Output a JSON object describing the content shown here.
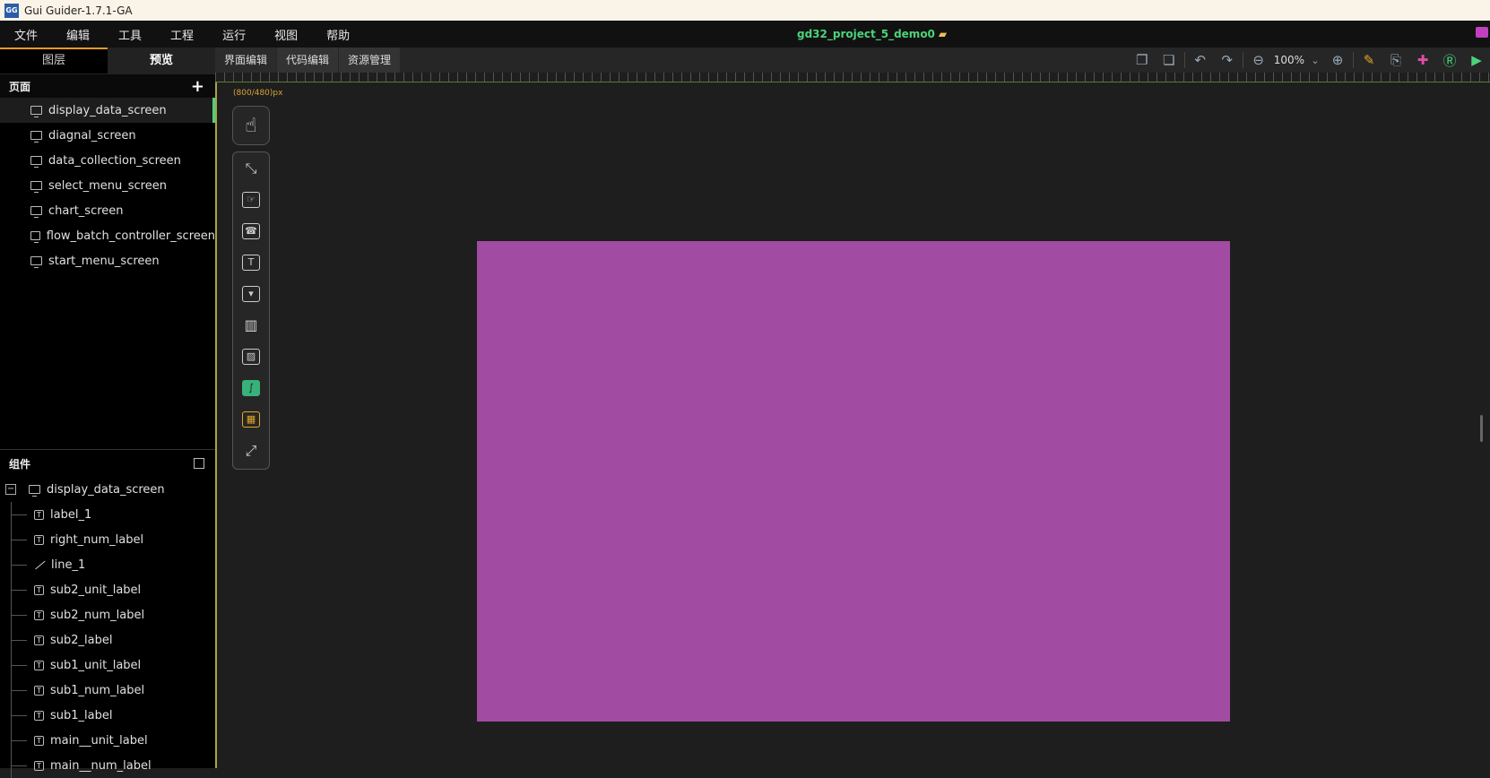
{
  "window": {
    "title": "Gui Guider-1.7.1-GA",
    "app_icon_text": "GG"
  },
  "menu": {
    "items": [
      "文件",
      "编辑",
      "工具",
      "工程",
      "运行",
      "视图",
      "帮助"
    ],
    "project_name": "gd32_project_5_demo0"
  },
  "left_tabs": {
    "layers": "图层",
    "preview": "预览"
  },
  "pages": {
    "header": "页面",
    "items": [
      "display_data_screen",
      "diagnal_screen",
      "data_collection_screen",
      "select_menu_screen",
      "chart_screen",
      "flow_batch_controller_screen",
      "start_menu_screen"
    ]
  },
  "components": {
    "header": "组件",
    "root": "display_data_screen",
    "children": [
      {
        "label": "label_1",
        "icon": "text-icon"
      },
      {
        "label": "right_num_label",
        "icon": "text-icon"
      },
      {
        "label": "line_1",
        "icon": "line-icon"
      },
      {
        "label": "sub2_unit_label",
        "icon": "text-icon"
      },
      {
        "label": "sub2_num_label",
        "icon": "text-icon"
      },
      {
        "label": "sub2_label",
        "icon": "text-icon"
      },
      {
        "label": "sub1_unit_label",
        "icon": "text-icon"
      },
      {
        "label": "sub1_num_label",
        "icon": "text-icon"
      },
      {
        "label": "sub1_label",
        "icon": "text-icon"
      },
      {
        "label": "main__unit_label",
        "icon": "text-icon"
      },
      {
        "label": "main__num_label",
        "icon": "text-icon"
      }
    ]
  },
  "editor_tabs": [
    "界面编辑",
    "代码编辑",
    "资源管理"
  ],
  "toolbar": {
    "zoom": "100%"
  },
  "canvas": {
    "size_label": "(800/480)px",
    "screen_color": "#a24ba2"
  },
  "colors": {
    "accent_green": "#4bd37b",
    "tab_orange": "#e79a2a",
    "qr_orange": "#e5a727"
  }
}
